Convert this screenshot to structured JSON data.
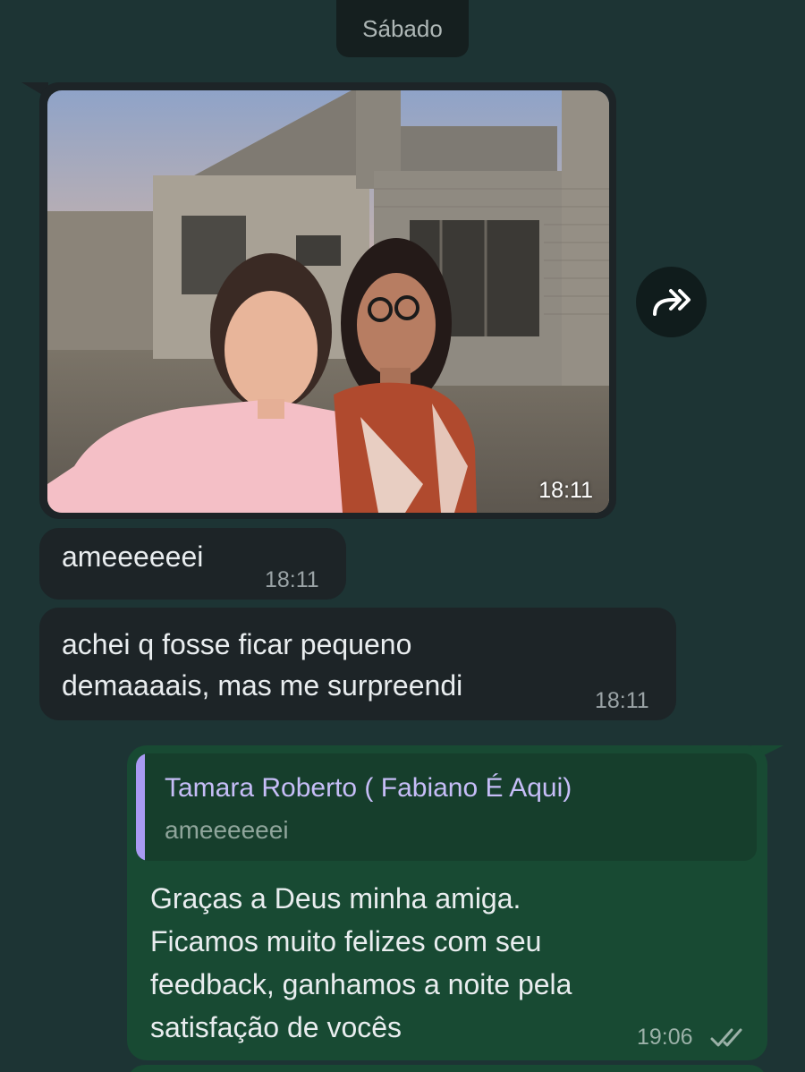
{
  "date_separator": "Sábado",
  "messages": [
    {
      "type": "image",
      "direction": "incoming",
      "time": "18:11"
    },
    {
      "type": "text",
      "direction": "incoming",
      "text": "ameeeeeei",
      "time": "18:11"
    },
    {
      "type": "text",
      "direction": "incoming",
      "lines": [
        "achei q fosse ficar pequeno",
        "demaaaais, mas me surpreendi"
      ],
      "time": "18:11"
    },
    {
      "type": "text",
      "direction": "outgoing",
      "reply": {
        "author": "Tamara Roberto ( Fabiano É Aqui)",
        "text": "ameeeeeei"
      },
      "lines": [
        "Graças a Deus minha amiga.",
        "Ficamos muito felizes com seu",
        "feedback, ganhamos a noite pela",
        "satisfação de vocês"
      ],
      "time": "19:06",
      "status": "read"
    }
  ],
  "icons": {
    "forward": "forward-icon",
    "read_receipt": "double-check-icon"
  },
  "colors": {
    "background": "#1d3434",
    "incoming_bubble": "#1d2427",
    "outgoing_bubble": "#184a33",
    "reply_accent": "#a99af2"
  }
}
